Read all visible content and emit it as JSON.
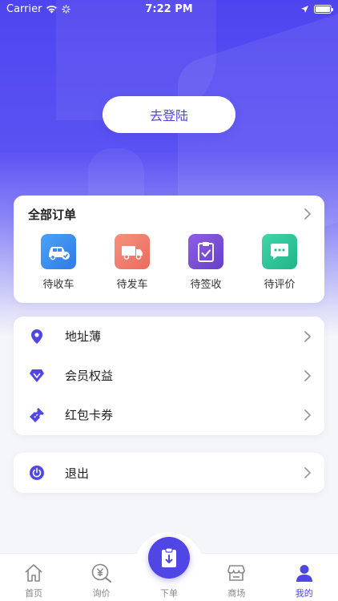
{
  "status_bar": {
    "carrier": "Carrier",
    "time": "7:22 PM"
  },
  "login_button": "去登陆",
  "orders": {
    "title": "全部订单",
    "items": [
      {
        "label": "待收车",
        "icon": "car-check-icon",
        "color": "#3a8ef0"
      },
      {
        "label": "待发车",
        "icon": "truck-icon",
        "color": "#f07a6a"
      },
      {
        "label": "待签收",
        "icon": "clipboard-check-icon",
        "color": "#7a52d8"
      },
      {
        "label": "待评价",
        "icon": "chat-bubble-icon",
        "color": "#2fc59a"
      }
    ]
  },
  "menu": {
    "items": [
      {
        "label": "地址薄",
        "icon": "location-pin-icon"
      },
      {
        "label": "会员权益",
        "icon": "diamond-icon"
      },
      {
        "label": "红包卡券",
        "icon": "ticket-icon"
      }
    ],
    "logout": {
      "label": "退出",
      "icon": "power-icon"
    }
  },
  "tabbar": {
    "items": [
      {
        "label": "首页",
        "icon": "home-icon"
      },
      {
        "label": "询价",
        "icon": "yuan-search-icon"
      },
      {
        "label": "下单",
        "icon": "clipboard-download-icon"
      },
      {
        "label": "商场",
        "icon": "store-icon"
      },
      {
        "label": "我的",
        "icon": "user-icon"
      }
    ],
    "active_index": 4
  },
  "colors": {
    "accent": "#4f46e5"
  }
}
